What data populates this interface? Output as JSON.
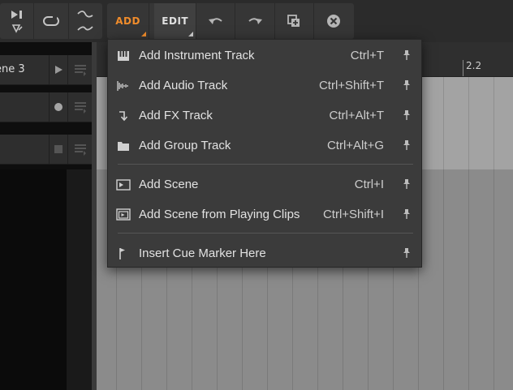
{
  "toolbar": {
    "add_label": "ADD",
    "edit_label": "EDIT"
  },
  "tracks": [
    {
      "name": "ene 3",
      "ctrl_icon": "play-icon"
    },
    {
      "name": "",
      "ctrl_icon": "record-icon"
    },
    {
      "name": "",
      "ctrl_icon": "stop-icon"
    }
  ],
  "ruler": {
    "marker": "2.2"
  },
  "menu": {
    "items": [
      {
        "label": "Add Instrument Track",
        "shortcut": "Ctrl+T",
        "icon": "piano-keys-icon"
      },
      {
        "label": "Add Audio Track",
        "shortcut": "Ctrl+Shift+T",
        "icon": "waveform-icon"
      },
      {
        "label": "Add FX Track",
        "shortcut": "Ctrl+Alt+T",
        "icon": "fx-arrow-icon"
      },
      {
        "label": "Add Group Track",
        "shortcut": "Ctrl+Alt+G",
        "icon": "folder-icon"
      },
      {
        "label": "Add Scene",
        "shortcut": "Ctrl+I",
        "icon": "scene-icon"
      },
      {
        "label": "Add Scene from Playing Clips",
        "shortcut": "Ctrl+Shift+I",
        "icon": "scene-playing-icon"
      },
      {
        "label": "Insert Cue Marker Here",
        "shortcut": "",
        "icon": "cue-flag-icon"
      }
    ]
  },
  "colors": {
    "accent": "#f08c2b",
    "menu_bg": "#3b3b3b",
    "toolbar_bg": "#2b2b2b"
  }
}
